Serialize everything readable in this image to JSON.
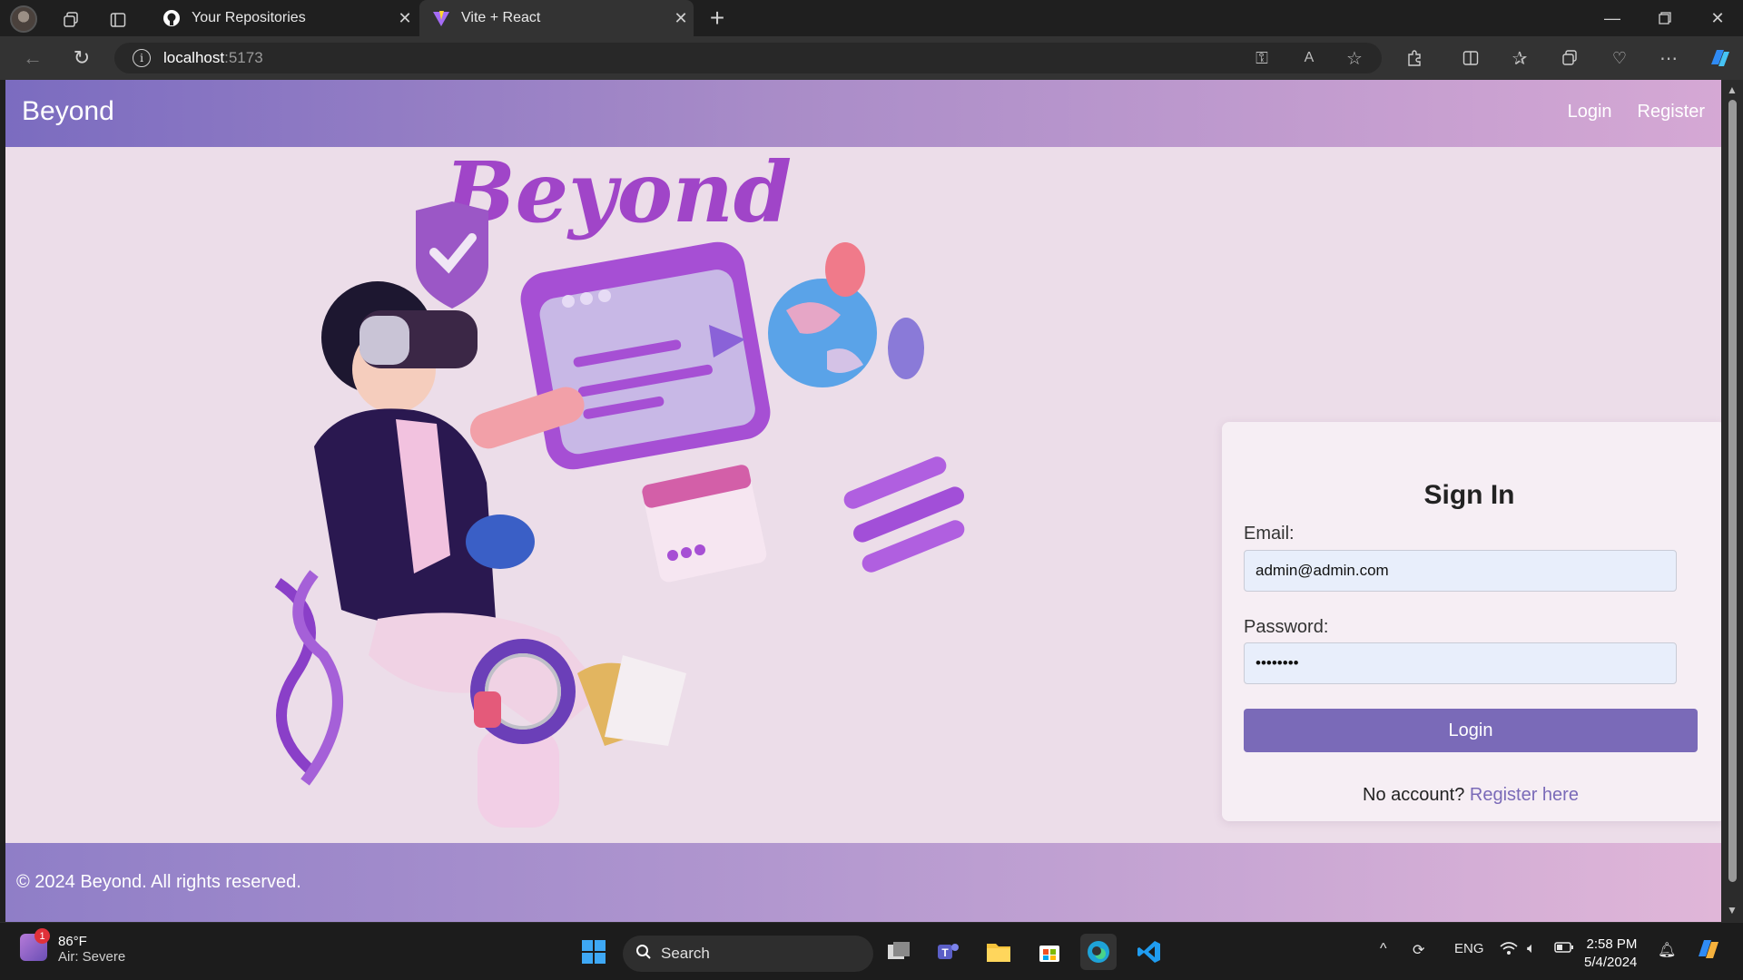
{
  "browser": {
    "tabs": [
      {
        "title": "Your Repositories"
      },
      {
        "title": "Vite + React"
      }
    ],
    "url_host": "localhost",
    "url_port": ":5173"
  },
  "navbar": {
    "brand": "Beyond",
    "links": [
      "Login",
      "Register"
    ]
  },
  "hero": {
    "logo_text": "Beyond"
  },
  "signin": {
    "heading": "Sign In",
    "email_label": "Email:",
    "email_value": "admin@admin.com",
    "password_label": "Password:",
    "password_value": "••••••••",
    "button": "Login",
    "no_account": "No account?",
    "register_link": "Register here"
  },
  "footer": {
    "text": "© 2024 Beyond. All rights reserved."
  },
  "taskbar": {
    "weather_temp": "86°F",
    "weather_desc": "Air: Severe",
    "weather_badge": "1",
    "search_placeholder": "Search",
    "language": "ENG",
    "time": "2:58 PM",
    "date": "5/4/2024"
  },
  "colors": {
    "accent": "#7a6ab8",
    "page_bg": "#ecdde9",
    "link": "#7a6ab8"
  }
}
